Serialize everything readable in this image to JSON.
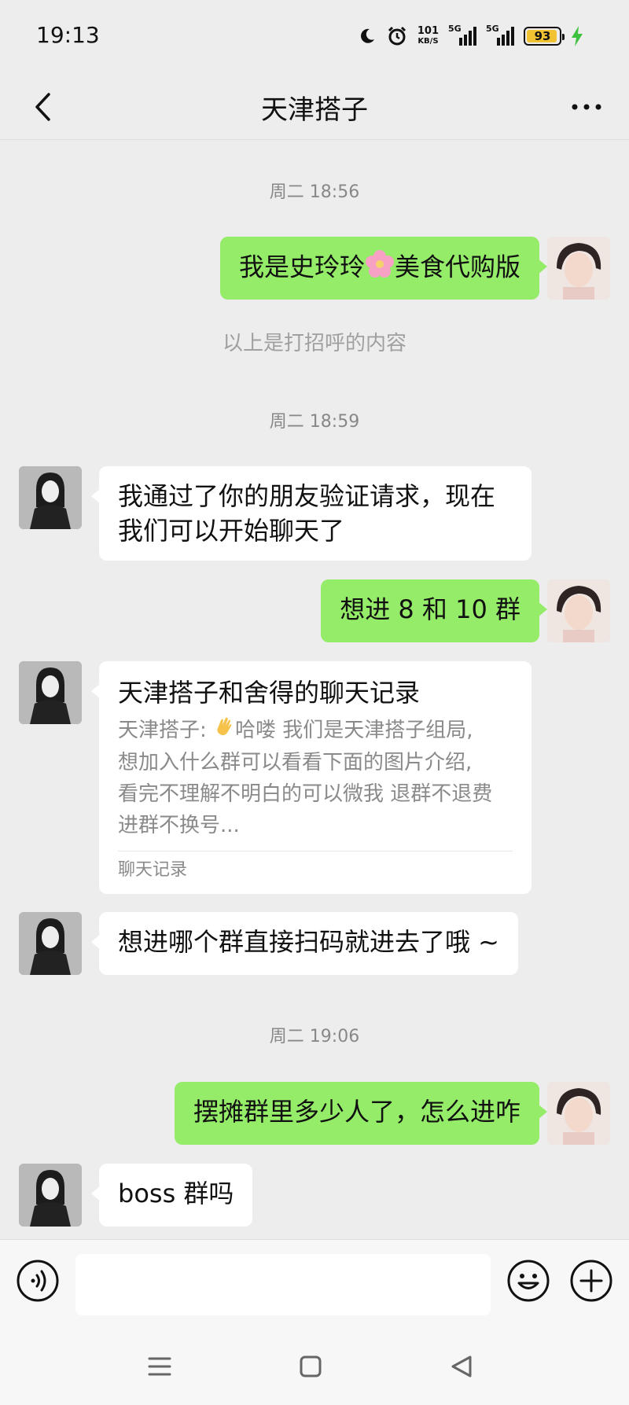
{
  "status_bar": {
    "time": "19:13",
    "net_speed_value": "101",
    "net_speed_unit": "KB/S",
    "signal_1_label": "5G",
    "signal_2_label": "5G",
    "battery": "93"
  },
  "header": {
    "title": "天津搭子"
  },
  "messages": {
    "ts1": "周二 18:56",
    "m1_part1": "我是史玲玲",
    "m1_part2": "美食代购版",
    "hint": "以上是打招呼的内容",
    "ts2": "周二 18:59",
    "m2_line1": "我通过了你的朋友验证请求，现在",
    "m2_line2": "我们可以开始聊天了",
    "m3": "想进 8 和 10 群",
    "record_title": "天津搭子和舍得的聊天记录",
    "record_preview_prefix": "天津搭子: ",
    "record_preview_line1": "哈喽 我们是天津搭子组局,",
    "record_preview_line2": "想加入什么群可以看看下面的图片介绍,",
    "record_preview_line3": "看完不理解不明白的可以微我 退群不退费",
    "record_preview_line4": "进群不换号...",
    "record_label": "聊天记录",
    "m5": "想进哪个群直接扫码就进去了哦 ~",
    "ts3": "周二 19:06",
    "m6": "摆摊群里多少人了，怎么进咋",
    "m7": "boss 群吗"
  },
  "input": {
    "placeholder": ""
  },
  "colors": {
    "sent_bubble": "#95ec69",
    "received_bubble": "#ffffff",
    "background": "#ededed",
    "battery": "#f1c232"
  },
  "icons": {
    "back": "chevron-left-icon",
    "more": "more-dots-icon",
    "voice": "voice-icon",
    "emoji": "emoji-icon",
    "plus": "plus-icon",
    "wave": "waving-hand-icon",
    "flower": "cherry-blossom-icon"
  }
}
